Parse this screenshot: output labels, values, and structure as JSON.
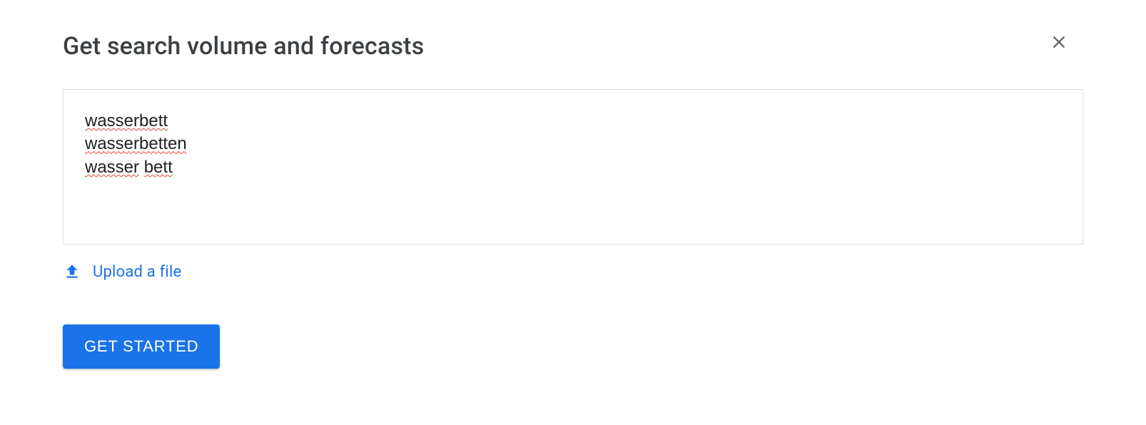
{
  "header": {
    "title": "Get search volume and forecasts"
  },
  "textarea": {
    "lines": [
      "wasserbett",
      "wasserbetten",
      "wasser bett"
    ]
  },
  "upload": {
    "label": "Upload a file"
  },
  "actions": {
    "primary_label": "GET STARTED"
  }
}
